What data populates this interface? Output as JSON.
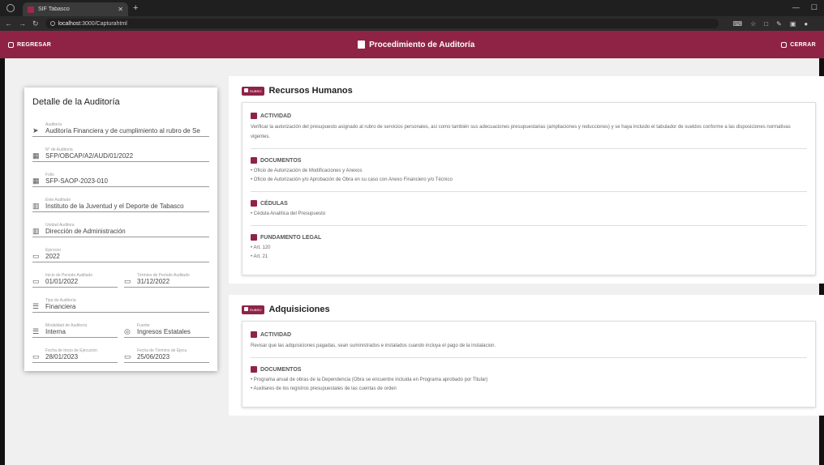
{
  "browser": {
    "tab_title": "SIF Tabasco",
    "url_host": "localhost",
    "url_path": ":3000/Capturahtml"
  },
  "header": {
    "back_label": "REGRESAR",
    "title": "Procedimiento de Auditoría",
    "close_label": "CERRAR"
  },
  "detail": {
    "title": "Detalle de la Auditoría",
    "fields": [
      {
        "label": "Auditoría",
        "value": "Auditoría Financiera y de cumplimiento al rubro de Se"
      },
      {
        "label": "N° de Auditoría",
        "value": "SFP/OBCAP/A2/AUD/01/2022"
      },
      {
        "label": "Folio",
        "value": "SFP-SAOP-2023-010"
      },
      {
        "label": "Ente Auditado",
        "value": "Instituto de la Juventud y el Deporte de Tabasco"
      },
      {
        "label": "Unidad Auditora",
        "value": "Dirección de Administración"
      },
      {
        "label": "Ejercicio",
        "value": "2022"
      }
    ],
    "pairs": [
      [
        {
          "label": "Inicio de Periodo Auditado",
          "value": "01/01/2022"
        },
        {
          "label": "Término de Periodo Auditado",
          "value": "31/12/2022"
        }
      ]
    ],
    "tipo": {
      "label": "Tipo de Auditoría",
      "value": "Financiera"
    },
    "pairs2": [
      [
        {
          "label": "Modalidad de Auditoría",
          "value": "Interna"
        },
        {
          "label": "Fuente",
          "value": "Ingresos Estatales"
        }
      ],
      [
        {
          "label": "Fecha de Inicio de Ejecución",
          "value": "28/01/2023"
        },
        {
          "label": "Fecha de Término de Ejecu",
          "value": "25/06/2023"
        }
      ]
    ]
  },
  "sections": [
    {
      "tag": "RUBRO",
      "name": "Recursos Humanos",
      "actividad_title": "ACTIVIDAD",
      "actividad": "Verificar la autorización del presupuesto asignado al rubro de servicios personales, así como también sus adecuaciones presupuestarias (ampliaciones y reducciones) y se haya incluido el tabulador de sueldos conforme a las disposiciones normativas vigentes.",
      "documentos_title": "DOCUMENTOS",
      "documentos": [
        "Oficio de Autorización de Modificaciones y Anexos",
        "Oficio de Autorización y/o Aprobación de Obra en su caso con Anexo Financiero y/o Técnico"
      ],
      "cedulas_title": "CÉDULAS",
      "cedulas": [
        "Cédula Analítica del Presupuesto"
      ],
      "fundamento_title": "FUNDAMENTO LEGAL",
      "fundamento": [
        "Art. 120",
        "Art. 21"
      ]
    },
    {
      "tag": "RUBRO",
      "name": "Adquisiciones",
      "actividad_title": "ACTIVIDAD",
      "actividad": "Revisar que las adquisiciones pagadas, sean suministrados e instalados cuando incluya el pago de la instalacion.",
      "documentos_title": "DOCUMENTOS",
      "documentos": [
        "Programa anual de obras de la Dependencia (Obra se encuentre incluida en Programa aprobado por Titular)",
        "Auxiliares de los registros presupuestales de las cuentas de orden"
      ]
    }
  ]
}
